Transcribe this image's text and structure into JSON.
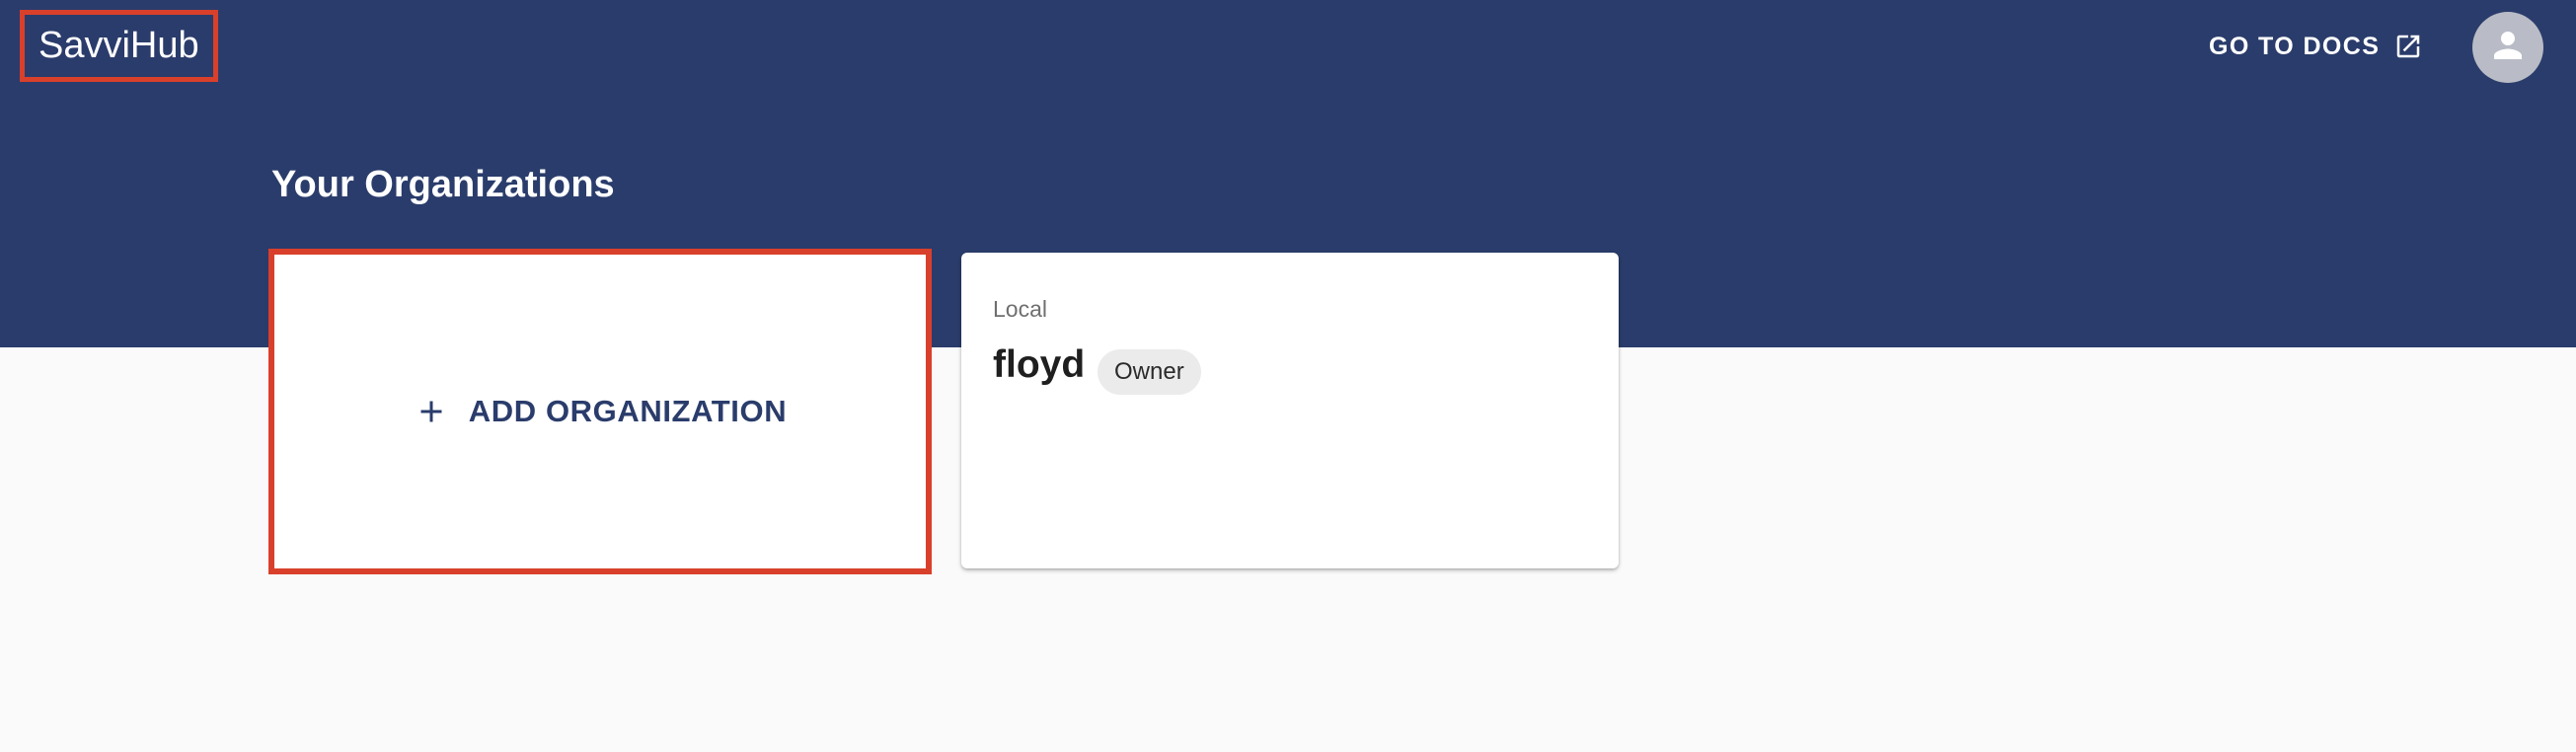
{
  "app": {
    "name": "SavviHub"
  },
  "header": {
    "docs_label": "GO TO DOCS",
    "docs_icon": "external-link-icon",
    "avatar_icon": "person-icon"
  },
  "main": {
    "title": "Your Organizations",
    "add_card": {
      "label": "ADD ORGANIZATION",
      "icon": "plus-icon"
    },
    "organizations": [
      {
        "type": "Local",
        "name": "floyd",
        "role": "Owner"
      }
    ]
  },
  "colors": {
    "header_bg": "#2a3c6b",
    "page_bg": "#fafafa",
    "highlight": "#d9402b",
    "accent_text": "#2a3c6b"
  }
}
